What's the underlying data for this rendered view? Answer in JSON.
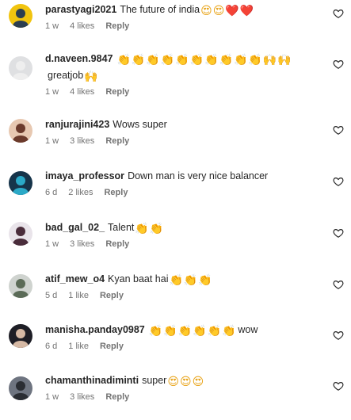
{
  "comments": [
    {
      "username": "parastyagi2021",
      "text": "The future of india",
      "emojis": [
        "😍",
        "😍",
        "❤️",
        "❤️"
      ],
      "time": "1 w",
      "likes": "4 likes",
      "reply": "Reply",
      "avatar_colors": [
        "#f1c40f",
        "#2c3e50"
      ]
    },
    {
      "username": "d.naveen.9847",
      "text": "",
      "emojis": [
        "👏",
        "👏",
        "👏",
        "👏",
        "👏",
        "👏",
        "👏",
        "👏",
        "👏",
        "👏",
        "🙌",
        "🙌"
      ],
      "text_after": "greatjob",
      "emojis_after": [
        "🙌"
      ],
      "time": "1 w",
      "likes": "4 likes",
      "reply": "Reply",
      "avatar_colors": [
        "#dfe0e2",
        "#eeeeee"
      ]
    },
    {
      "username": "ranjurajini423",
      "text": "Wows super",
      "emojis": [],
      "time": "1 w",
      "likes": "3 likes",
      "reply": "Reply",
      "avatar_colors": [
        "#e7c8b1",
        "#6b3a2b"
      ]
    },
    {
      "username": "imaya_professor",
      "text": "Down man is very nice balancer",
      "emojis": [],
      "time": "6 d",
      "likes": "2 likes",
      "reply": "Reply",
      "avatar_colors": [
        "#16344a",
        "#2ba9c7"
      ]
    },
    {
      "username": "bad_gal_02_",
      "text": "Talent",
      "emojis": [
        "👏",
        "👏"
      ],
      "time": "1 w",
      "likes": "3 likes",
      "reply": "Reply",
      "avatar_colors": [
        "#e9e4ea",
        "#4a2d3b"
      ]
    },
    {
      "username": "atif_mew_o4",
      "text": "Kyan baat hai",
      "emojis": [
        "👏",
        "👏",
        "👏"
      ],
      "time": "5 d",
      "likes": "1 like",
      "reply": "Reply",
      "avatar_colors": [
        "#cfd3cf",
        "#5b6b57"
      ]
    },
    {
      "username": "manisha.panday0987",
      "text": "",
      "emojis": [
        "👏",
        "👏",
        "👏",
        "👏",
        "👏",
        "👏"
      ],
      "text_after": "wow",
      "emojis_after": [],
      "time": "6 d",
      "likes": "1 like",
      "reply": "Reply",
      "avatar_colors": [
        "#1e1e26",
        "#d6b9a5"
      ]
    },
    {
      "username": "chamanthinadiminti",
      "text": "super",
      "emojis": [
        "😍",
        "😍",
        "😍"
      ],
      "time": "1 w",
      "likes": "3 likes",
      "reply": "Reply",
      "avatar_colors": [
        "#6e7480",
        "#2a2d33"
      ]
    }
  ],
  "icons": {
    "like": "heart-outline-icon"
  }
}
